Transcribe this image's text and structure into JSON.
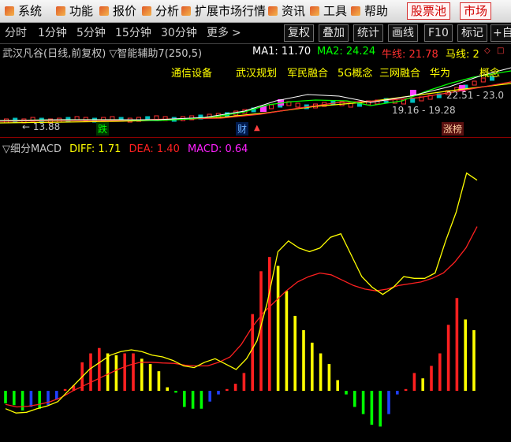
{
  "menu": {
    "items": [
      "系统",
      "功能",
      "报价",
      "分析",
      "扩展市场行情",
      "资讯",
      "工具",
      "帮助"
    ],
    "highlight_items": [
      "股票池",
      "市场"
    ]
  },
  "toolbar": {
    "periods": [
      "分时",
      "1分钟",
      "5分钟",
      "15分钟",
      "30分钟"
    ],
    "more_label": "更多",
    "more_icon": "chevron-right-icon",
    "buttons": [
      "复权",
      "叠加",
      "统计",
      "画线",
      "F10",
      "标记",
      "+自"
    ]
  },
  "price_pane": {
    "title": "武汉凡谷(日线,前复权)",
    "indicator": "▽智能辅助7(250,5)",
    "ma1_label": "MA1: 11.70",
    "ma2_label": "MA2: 24.24",
    "niu_label": "牛线: 21.78",
    "ma_label": "马线: 2",
    "concepts": [
      "通信设备",
      "武汉规划",
      "军民融合",
      "5G概念",
      "三网融合",
      "华为"
    ],
    "concept_tail": "概念",
    "range_text": "19.16 - 19.28",
    "right_price": "22.51 - 23.0",
    "low_price": "← 13.88",
    "tag_die": "跌",
    "tag_cai": "财",
    "tag_zhangbang": "涨榜",
    "colors": {
      "ma1": "#ffffff",
      "ma2": "#00ff00",
      "niu": "#ff3030",
      "ma": "#ffff00"
    }
  },
  "macd_pane": {
    "title": "▽细分MACD",
    "diff_label": "DIFF: 1.71",
    "dea_label": "DEA: 1.40",
    "macd_label": "MACD: 0.64",
    "colors": {
      "diff": "#ffff00",
      "dea": "#ff2020",
      "macd": "#ff20ff"
    }
  },
  "chart_data": {
    "type": "bar",
    "title": "细分MACD",
    "series": [
      {
        "name": "MACD",
        "values": [
          -0.35,
          -0.4,
          -0.55,
          -0.45,
          -0.5,
          -0.4,
          -0.25,
          0.05,
          0.15,
          0.8,
          1.05,
          1.2,
          1.05,
          1.0,
          1.05,
          1.05,
          0.9,
          0.75,
          0.55,
          0.1,
          -0.05,
          -0.45,
          -0.5,
          -0.5,
          -0.3,
          -0.1,
          0.05,
          0.2,
          0.5,
          2.15,
          3.35,
          3.75,
          3.5,
          2.8,
          2.1,
          1.7,
          1.35,
          1.05,
          0.75,
          0.3,
          -0.1,
          -0.45,
          -0.65,
          -0.95,
          -1.0,
          -0.65,
          -0.1,
          0.05,
          0.5,
          0.35,
          0.7,
          1.05,
          1.85,
          2.6,
          2.0,
          1.7
        ]
      },
      {
        "name": "DIFF",
        "values": [
          -0.5,
          -0.62,
          -0.6,
          -0.5,
          -0.42,
          -0.3,
          0.0,
          0.3,
          0.6,
          0.8,
          1.0,
          1.1,
          1.15,
          1.1,
          1.0,
          0.95,
          0.85,
          0.7,
          0.65,
          0.8,
          0.9,
          0.75,
          0.6,
          0.9,
          1.4,
          2.5,
          3.9,
          4.2,
          4.0,
          3.9,
          4.0,
          4.3,
          4.4,
          3.8,
          3.2,
          2.9,
          2.7,
          2.9,
          3.2,
          3.15,
          3.15,
          3.3,
          4.2,
          5.0,
          6.1,
          5.9
        ]
      },
      {
        "name": "DEA",
        "values": [
          -0.38,
          -0.45,
          -0.43,
          -0.38,
          -0.3,
          -0.18,
          0.0,
          0.15,
          0.3,
          0.45,
          0.6,
          0.72,
          0.8,
          0.8,
          0.78,
          0.77,
          0.72,
          0.7,
          0.7,
          0.8,
          0.95,
          1.3,
          1.8,
          2.2,
          2.5,
          2.8,
          3.05,
          3.2,
          3.3,
          3.25,
          3.1,
          2.95,
          2.85,
          2.8,
          2.85,
          2.95,
          3.0,
          3.05,
          3.15,
          3.3,
          3.6,
          4.0,
          4.6
        ]
      }
    ],
    "ylim": [
      -1.3,
      6.6
    ],
    "colors": {
      "up_red": "#ff2020",
      "up_yellow": "#ffff00",
      "down_green": "#00ff00",
      "down_blue": "#2040ff"
    }
  }
}
